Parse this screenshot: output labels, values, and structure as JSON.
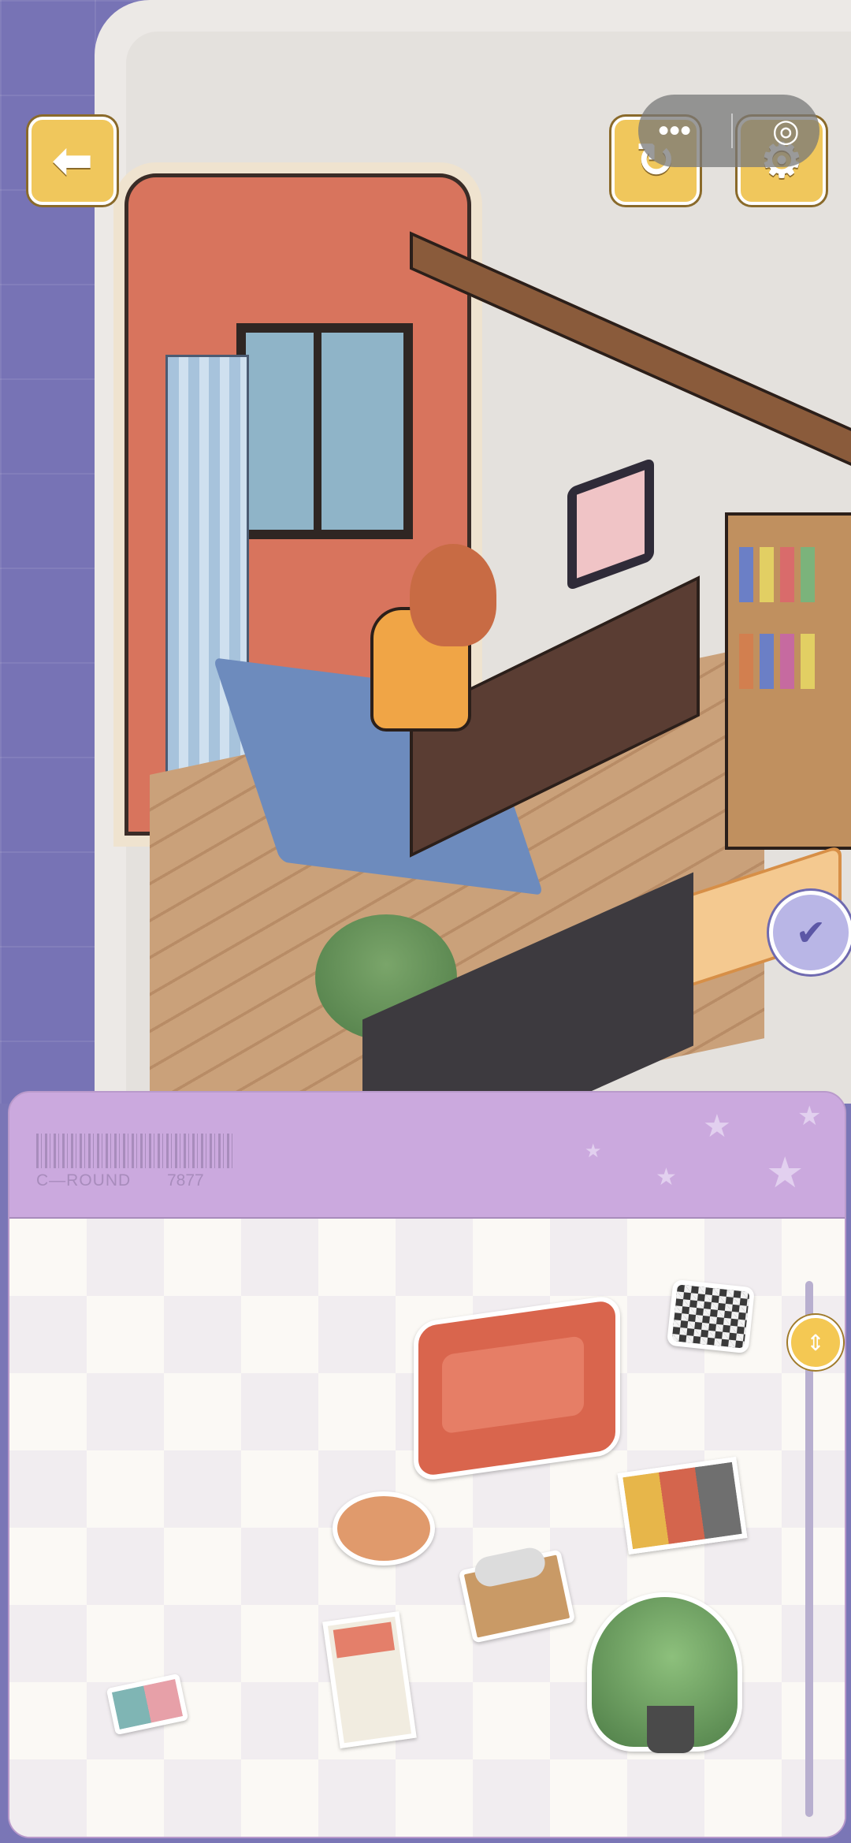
{
  "header": {
    "back_icon": "arrow-left-icon",
    "capsule_more": "•••",
    "capsule_target": "◎",
    "refresh_icon": "refresh-icon",
    "settings_icon": "gear-icon"
  },
  "scene": {
    "search_icon": "magnifier-check-icon",
    "colors": {
      "wall": "#d8745d",
      "rug": "#6d8bbd",
      "desk": "#5a3d33",
      "background": "#7773b5"
    }
  },
  "tray": {
    "code_label": "C—ROUND",
    "code_number": "7877",
    "scroll_progress": 0.06,
    "items": [
      {
        "name": "red-sofa"
      },
      {
        "name": "checkered-mat"
      },
      {
        "name": "round-cushion"
      },
      {
        "name": "poster-strip"
      },
      {
        "name": "tissue-box"
      },
      {
        "name": "calendar"
      },
      {
        "name": "potted-plant"
      },
      {
        "name": "small-book"
      }
    ]
  }
}
